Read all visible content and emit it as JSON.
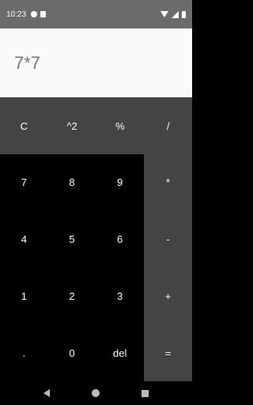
{
  "status_bar": {
    "time": "10:23"
  },
  "display": {
    "expression": "7*7"
  },
  "top_row": [
    {
      "label": "C",
      "name": "clear-button"
    },
    {
      "label": "^2",
      "name": "square-button"
    },
    {
      "label": "%",
      "name": "percent-button"
    },
    {
      "label": "/",
      "name": "divide-button"
    }
  ],
  "numpad": [
    {
      "label": "7",
      "name": "digit-7-button"
    },
    {
      "label": "8",
      "name": "digit-8-button"
    },
    {
      "label": "9",
      "name": "digit-9-button"
    },
    {
      "label": "4",
      "name": "digit-4-button"
    },
    {
      "label": "5",
      "name": "digit-5-button"
    },
    {
      "label": "6",
      "name": "digit-6-button"
    },
    {
      "label": "1",
      "name": "digit-1-button"
    },
    {
      "label": "2",
      "name": "digit-2-button"
    },
    {
      "label": "3",
      "name": "digit-3-button"
    },
    {
      "label": ".",
      "name": "decimal-button"
    },
    {
      "label": "0",
      "name": "digit-0-button"
    },
    {
      "label": "del",
      "name": "delete-button"
    }
  ],
  "ops": [
    {
      "label": "*",
      "name": "multiply-button"
    },
    {
      "label": "-",
      "name": "subtract-button"
    },
    {
      "label": "+",
      "name": "add-button"
    },
    {
      "label": "=",
      "name": "equals-button"
    }
  ],
  "colors": {
    "status_bar": "#6b6b6b",
    "display_bg": "#fafafa",
    "display_text": "#757575",
    "operator_bg": "#444444",
    "numpad_bg": "#000000"
  },
  "nav_bar": {
    "icons": [
      "back-icon",
      "home-icon",
      "recents-icon"
    ]
  }
}
